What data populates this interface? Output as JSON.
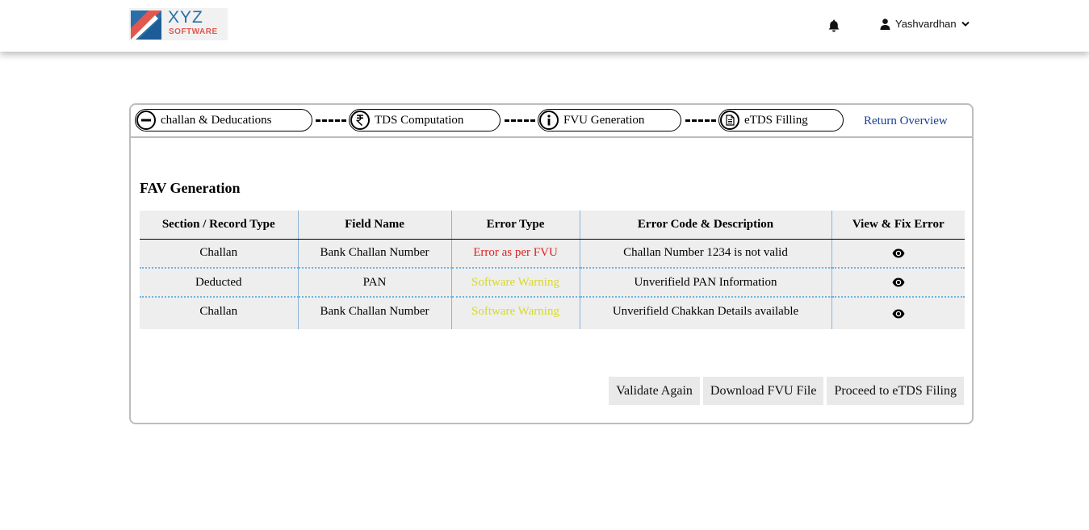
{
  "brand": {
    "logo_text": "XYZ",
    "logo_sub": "SOFTWARE",
    "colors": {
      "blue": "#2a6fa8",
      "red": "#e4574e"
    }
  },
  "header": {
    "notification_icon": "bell-icon",
    "user_name": "Yashvardhan",
    "user_icon": "user-icon",
    "dropdown_icon": "chevron-down-icon"
  },
  "steps": [
    {
      "label": "challan & Deducations",
      "icon": "minus-circle-icon"
    },
    {
      "label": "TDS Computation",
      "icon": "rupee-icon"
    },
    {
      "label": "FVU Generation",
      "icon": "info-icon"
    },
    {
      "label": "eTDS Filling",
      "icon": "document-icon"
    }
  ],
  "return_link": "Return Overview",
  "section_title": "FAV Generation",
  "table": {
    "headers": [
      "Section / Record Type",
      "Field Name",
      "Error Type",
      "Error Code & Description",
      "View & Fix Error"
    ],
    "rows": [
      {
        "section": "Challan",
        "field": "Bank Challan Number",
        "error_type": "Error as per FVU",
        "error_color": "#e02020",
        "description": "Challan Number 1234 is not valid",
        "action_icon": "eye-icon"
      },
      {
        "section": "Deducted",
        "field": "PAN",
        "error_type": "Software Warning",
        "error_color": "#d8d82a",
        "description": "Unverifield PAN Information",
        "action_icon": "eye-icon"
      },
      {
        "section": "Challan",
        "field": "Bank Challan Number",
        "error_type": "Software Warning",
        "error_color": "#d8d82a",
        "description": "Unverifield Chakkan Details available",
        "action_icon": "eye-icon"
      }
    ]
  },
  "actions": {
    "validate": "Validate Again",
    "download": "Download FVU File",
    "proceed": "Proceed to eTDS Filing"
  }
}
